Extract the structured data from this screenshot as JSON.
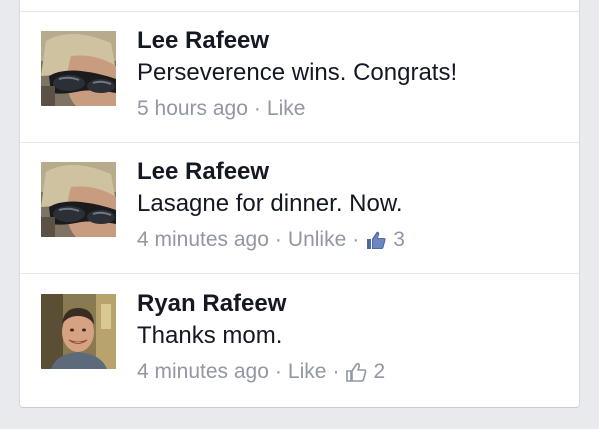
{
  "comments": [
    {
      "author": "Lee Rafeew",
      "text": "Perseverence wins.  Congrats!",
      "time": "5 hours ago",
      "action": "Like",
      "avatar_icon": "sunglasses-avatar"
    },
    {
      "author": "Lee Rafeew",
      "text": "Lasagne for dinner. Now.",
      "time": "4 minutes ago",
      "action": "Unlike",
      "likes": "3",
      "thumb_color": "#4e69a2",
      "avatar_icon": "sunglasses-avatar"
    },
    {
      "author": "Ryan Rafeew",
      "text": "Thanks mom.",
      "time": "4 minutes ago",
      "action": "Like",
      "likes": "2",
      "thumb_color": "#9197a3",
      "avatar_icon": "smiling-man-avatar"
    }
  ],
  "separator": "·",
  "colors": {
    "background": "#e9eaed",
    "name_text": "#141823",
    "meta_text": "#9197a3",
    "liked_thumb": "#4e69a2"
  }
}
